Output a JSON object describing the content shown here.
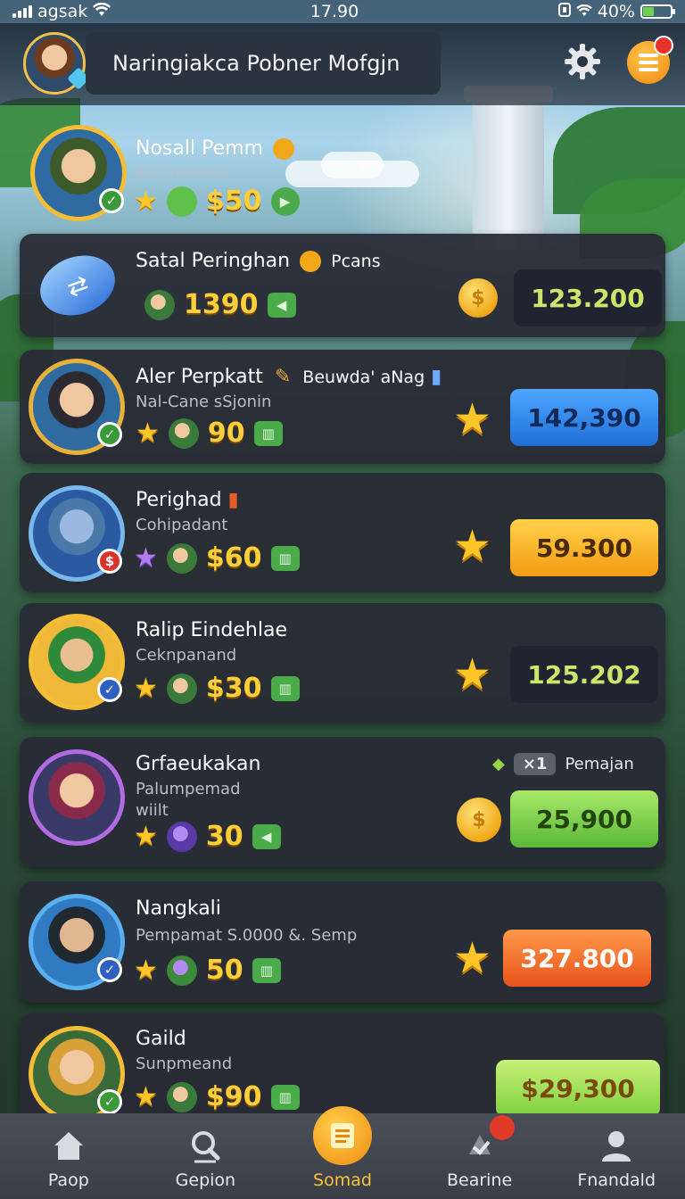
{
  "status_bar": {
    "carrier": "agsak",
    "time": "17.90",
    "battery": "40%"
  },
  "header": {
    "title": "Naringiakca Pobner Mofgjn",
    "avatar_icon": "player-avatar",
    "settings_icon": "gear-icon",
    "menu_icon": "menu-icon"
  },
  "hero": {
    "name": "Nosall Pemm",
    "subtitle": "Beclimenatoi",
    "amount": "$50"
  },
  "featured": {
    "name": "Satal Peringhan",
    "tag": "Pcans",
    "amount": "1390",
    "value": "123.200"
  },
  "rows": [
    {
      "name": "Aler Perpkatt",
      "name_extra": "Beuwda' aNag",
      "subtitle": "Nal-Cane sSjonin",
      "amount": "90",
      "value": "142,390",
      "value_style": "blue"
    },
    {
      "name": "Perighad",
      "subtitle": "Cohipadant",
      "amount": "$60",
      "value": "59.300",
      "value_style": "orange"
    },
    {
      "name": "Ralip Eindehlae",
      "subtitle": "Ceknpanand",
      "amount": "$30",
      "value": "125.202",
      "value_style": "dark"
    },
    {
      "name": "Grfaeukakan",
      "subtitle": "Palumpemad",
      "subtitle2": "wiilt",
      "amount": "30",
      "tag_badge": "×1",
      "tag_label": "Pemajan",
      "value": "25,900",
      "value_style": "green"
    },
    {
      "name": "Nangkali",
      "subtitle": "Pempamat S.0000 &. Semp",
      "amount": "50",
      "value": "327.800",
      "value_style": "red"
    },
    {
      "name": "Gaild",
      "subtitle": "Sunpmeand",
      "amount": "$90",
      "value": "$29,300",
      "value_style": "lime"
    }
  ],
  "nav": [
    {
      "label": "Paop",
      "icon": "home-icon"
    },
    {
      "label": "Gepion",
      "icon": "search-icon"
    },
    {
      "label": "Somad",
      "icon": "list-icon",
      "active": true
    },
    {
      "label": "Bearine",
      "icon": "bell-icon"
    },
    {
      "label": "Fnandald",
      "icon": "user-icon"
    }
  ]
}
